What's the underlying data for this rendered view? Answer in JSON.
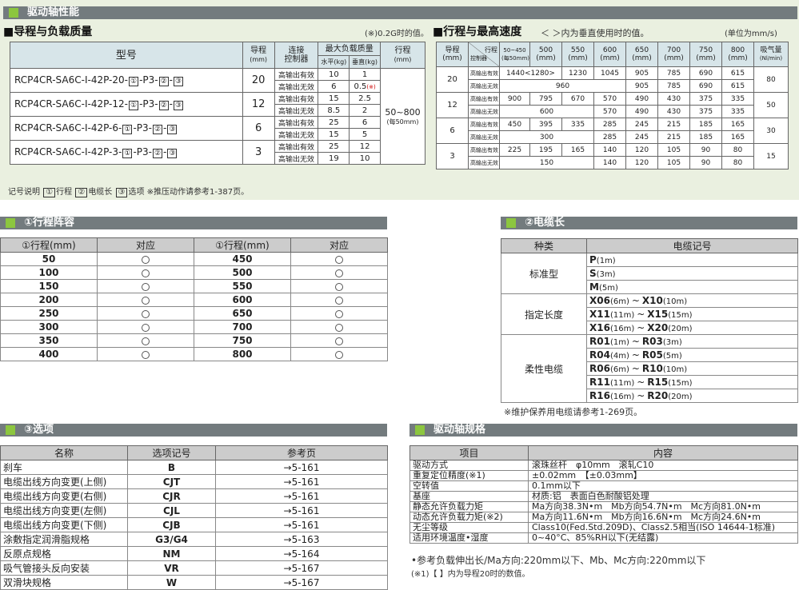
{
  "top": {
    "title": "驱动轴性能",
    "lead": {
      "heading": "■导程与负载质量",
      "note": "(※)0.2G时的值。",
      "headers": {
        "model": "型号",
        "lead": "导程",
        "lead_unit": "(mm)",
        "ctrl1": "连接",
        "ctrl2": "控制器",
        "maxload": "最大负载质量",
        "horiz": "水平(kg)",
        "vert": "垂直(kg)",
        "stroke": "行程",
        "stroke_unit": "(mm)"
      },
      "rows": [
        {
          "m1": "RCP4CR-SA6C-I-42P-20-",
          "m2": "-P3-",
          "m3": "-",
          "lead": "20",
          "c1": "高输出有效",
          "h1": "10",
          "v1": "1",
          "c2": "高输出无效",
          "h2": "6",
          "v2": "0.5",
          "v2s": "(※)"
        },
        {
          "m1": "RCP4CR-SA6C-I-42P-12-",
          "m2": "-P3-",
          "m3": "-",
          "lead": "12",
          "c1": "高输出有效",
          "h1": "15",
          "v1": "2.5",
          "c2": "高输出无效",
          "h2": "8.5",
          "v2": "2",
          "v2s": ""
        },
        {
          "m1": "RCP4CR-SA6C-I-42P-6-",
          "m2": "-P3-",
          "m3": "-",
          "lead": "6",
          "c1": "高输出有效",
          "h1": "25",
          "v1": "6",
          "c2": "高输出无效",
          "h2": "15",
          "v2": "5",
          "v2s": ""
        },
        {
          "m1": "RCP4CR-SA6C-I-42P-3-",
          "m2": "-P3-",
          "m3": "-",
          "lead": "3",
          "c1": "高输出有效",
          "h1": "25",
          "v1": "12",
          "c2": "高输出无效",
          "h2": "19",
          "v2": "10",
          "v2s": ""
        }
      ],
      "sym1": "①",
      "sym2": "②",
      "sym3": "③",
      "stroke": "50~800",
      "stroke_sub": "(每50mm)",
      "legend_prefix": "记号说明",
      "legend_1": "行程",
      "legend_2": "电缆长",
      "legend_3": "选项",
      "legend_note": "※推压动作请参考1-387页。"
    },
    "speed": {
      "heading": "■行程与最高速度",
      "sub": "＜ ＞内为垂直使用时的值。",
      "unit": "(单位为mm/s)",
      "h_lead": "导程",
      "h_lead_unit": "(mm)",
      "h_stroke": "行程",
      "h_ctrl": "控制器",
      "cols": [
        {
          "a": "50~450",
          "b": "(每50mm)"
        },
        {
          "a": "500",
          "b": "(mm)"
        },
        {
          "a": "550",
          "b": "(mm)"
        },
        {
          "a": "600",
          "b": "(mm)"
        },
        {
          "a": "650",
          "b": "(mm)"
        },
        {
          "a": "700",
          "b": "(mm)"
        },
        {
          "a": "750",
          "b": "(mm)"
        },
        {
          "a": "800",
          "b": "(mm)"
        }
      ],
      "h_air": "吸气量",
      "h_air_unit": "(Nl/min)",
      "on": "高输出有效",
      "off": "高输出无效",
      "groups": [
        {
          "lead": "20",
          "air": "80",
          "on_merged": "1440<1280>",
          "on_550": "1230",
          "on_600": "1045",
          "on_rest": [
            "905",
            "785",
            "690",
            "615"
          ],
          "off_merged": "960",
          "off_rest": [
            "905",
            "785",
            "690",
            "615"
          ]
        },
        {
          "lead": "12",
          "air": "50",
          "on": [
            "900",
            "795",
            "670",
            "570",
            "490",
            "430",
            "375",
            "335"
          ],
          "off_merged": "600",
          "off_rest": [
            "570",
            "490",
            "430",
            "375",
            "335"
          ]
        },
        {
          "lead": "6",
          "air": "30",
          "on": [
            "450",
            "395",
            "335",
            "285",
            "245",
            "215",
            "185",
            "165"
          ],
          "off_merged": "300",
          "off_rest": [
            "285",
            "245",
            "215",
            "185",
            "165"
          ]
        },
        {
          "lead": "3",
          "air": "15",
          "on": [
            "225",
            "195",
            "165",
            "140",
            "120",
            "105",
            "90",
            "80"
          ],
          "off_merged": "150",
          "off_rest": [
            "140",
            "120",
            "105",
            "90",
            "80"
          ]
        }
      ]
    }
  },
  "stroke_table": {
    "title": "①行程阵容",
    "h_stroke": "①行程(mm)",
    "h_ok": "对应",
    "left": [
      "50",
      "100",
      "150",
      "200",
      "250",
      "300",
      "350",
      "400"
    ],
    "right": [
      "450",
      "500",
      "550",
      "600",
      "650",
      "700",
      "750",
      "800"
    ]
  },
  "cable": {
    "title": "②电缆长",
    "h_kind": "种类",
    "h_code": "电缆记号",
    "kinds": [
      "标准型",
      "指定长度",
      "柔性电缆"
    ],
    "standard": [
      {
        "c": "P",
        "u": "(1m)"
      },
      {
        "c": "S",
        "u": "(3m)"
      },
      {
        "c": "M",
        "u": "(5m)"
      }
    ],
    "specified": [
      {
        "c1": "X06",
        "u1": "(6m)",
        "c2": "X10",
        "u2": "(10m)"
      },
      {
        "c1": "X11",
        "u1": "(11m)",
        "c2": "X15",
        "u2": "(15m)"
      },
      {
        "c1": "X16",
        "u1": "(16m)",
        "c2": "X20",
        "u2": "(20m)"
      }
    ],
    "flex": [
      {
        "c1": "R01",
        "u1": "(1m)",
        "c2": "R03",
        "u2": "(3m)"
      },
      {
        "c1": "R04",
        "u1": "(4m)",
        "c2": "R05",
        "u2": "(5m)"
      },
      {
        "c1": "R06",
        "u1": "(6m)",
        "c2": "R10",
        "u2": "(10m)"
      },
      {
        "c1": "R11",
        "u1": "(11m)",
        "c2": "R15",
        "u2": "(15m)"
      },
      {
        "c1": "R16",
        "u1": "(16m)",
        "c2": "R20",
        "u2": "(20m)"
      }
    ],
    "tilde": "~",
    "note": "※维护保养用电缆请参考1-269页。"
  },
  "options": {
    "title": "③选项",
    "h_name": "名称",
    "h_code": "选项记号",
    "h_page": "参考页",
    "rows": [
      {
        "n": "刹车",
        "c": "B",
        "p": "→5-161"
      },
      {
        "n": "电缆出线方向变更(上侧)",
        "c": "CJT",
        "p": "→5-161"
      },
      {
        "n": "电缆出线方向变更(右侧)",
        "c": "CJR",
        "p": "→5-161"
      },
      {
        "n": "电缆出线方向变更(左侧)",
        "c": "CJL",
        "p": "→5-161"
      },
      {
        "n": "电缆出线方向变更(下侧)",
        "c": "CJB",
        "p": "→5-161"
      },
      {
        "n": "涂敷指定润滑脂规格",
        "c": "G3/G4",
        "p": "→5-163"
      },
      {
        "n": "反原点规格",
        "c": "NM",
        "p": "→5-164"
      },
      {
        "n": "吸气管接头反向安装",
        "c": "VR",
        "p": "→5-167"
      },
      {
        "n": "双滑块规格",
        "c": "W",
        "p": "→5-167"
      }
    ]
  },
  "spec": {
    "title": "驱动轴规格",
    "h_item": "项目",
    "h_content": "内容",
    "rows": [
      {
        "k": "驱动方式",
        "v": "滚珠丝杆　φ10mm　滚轧C10"
      },
      {
        "k": "重复定位精度(※1)",
        "v": "±0.02mm　【±0.03mm】"
      },
      {
        "k": "空转值",
        "v": "0.1mm以下"
      },
      {
        "k": "基座",
        "v": "材质:铝　表面白色耐酸铝处理"
      },
      {
        "k": "静态允许负载力矩",
        "v": "Ma方向38.3N•m　Mb方向54.7N•m　Mc方向81.0N•m"
      },
      {
        "k": "动态允许负载力矩(※2)",
        "v": "Ma方向11.6N•m　Mb方向16.6N•m　Mc方向24.6N•m"
      },
      {
        "k": "无尘等级",
        "v": "Class10(Fed.Std.209D)、Class2.5相当(ISO 14644-1标准)"
      },
      {
        "k": "适用环境温度•湿度",
        "v": "0~40°C、85%RH以下(无结露)"
      }
    ],
    "note1": "•参考负载伸出长/Ma方向:220mm以下、Mb、Mc方向:220mm以下",
    "note2": "(※1)【 】内为导程20时的数值。"
  }
}
